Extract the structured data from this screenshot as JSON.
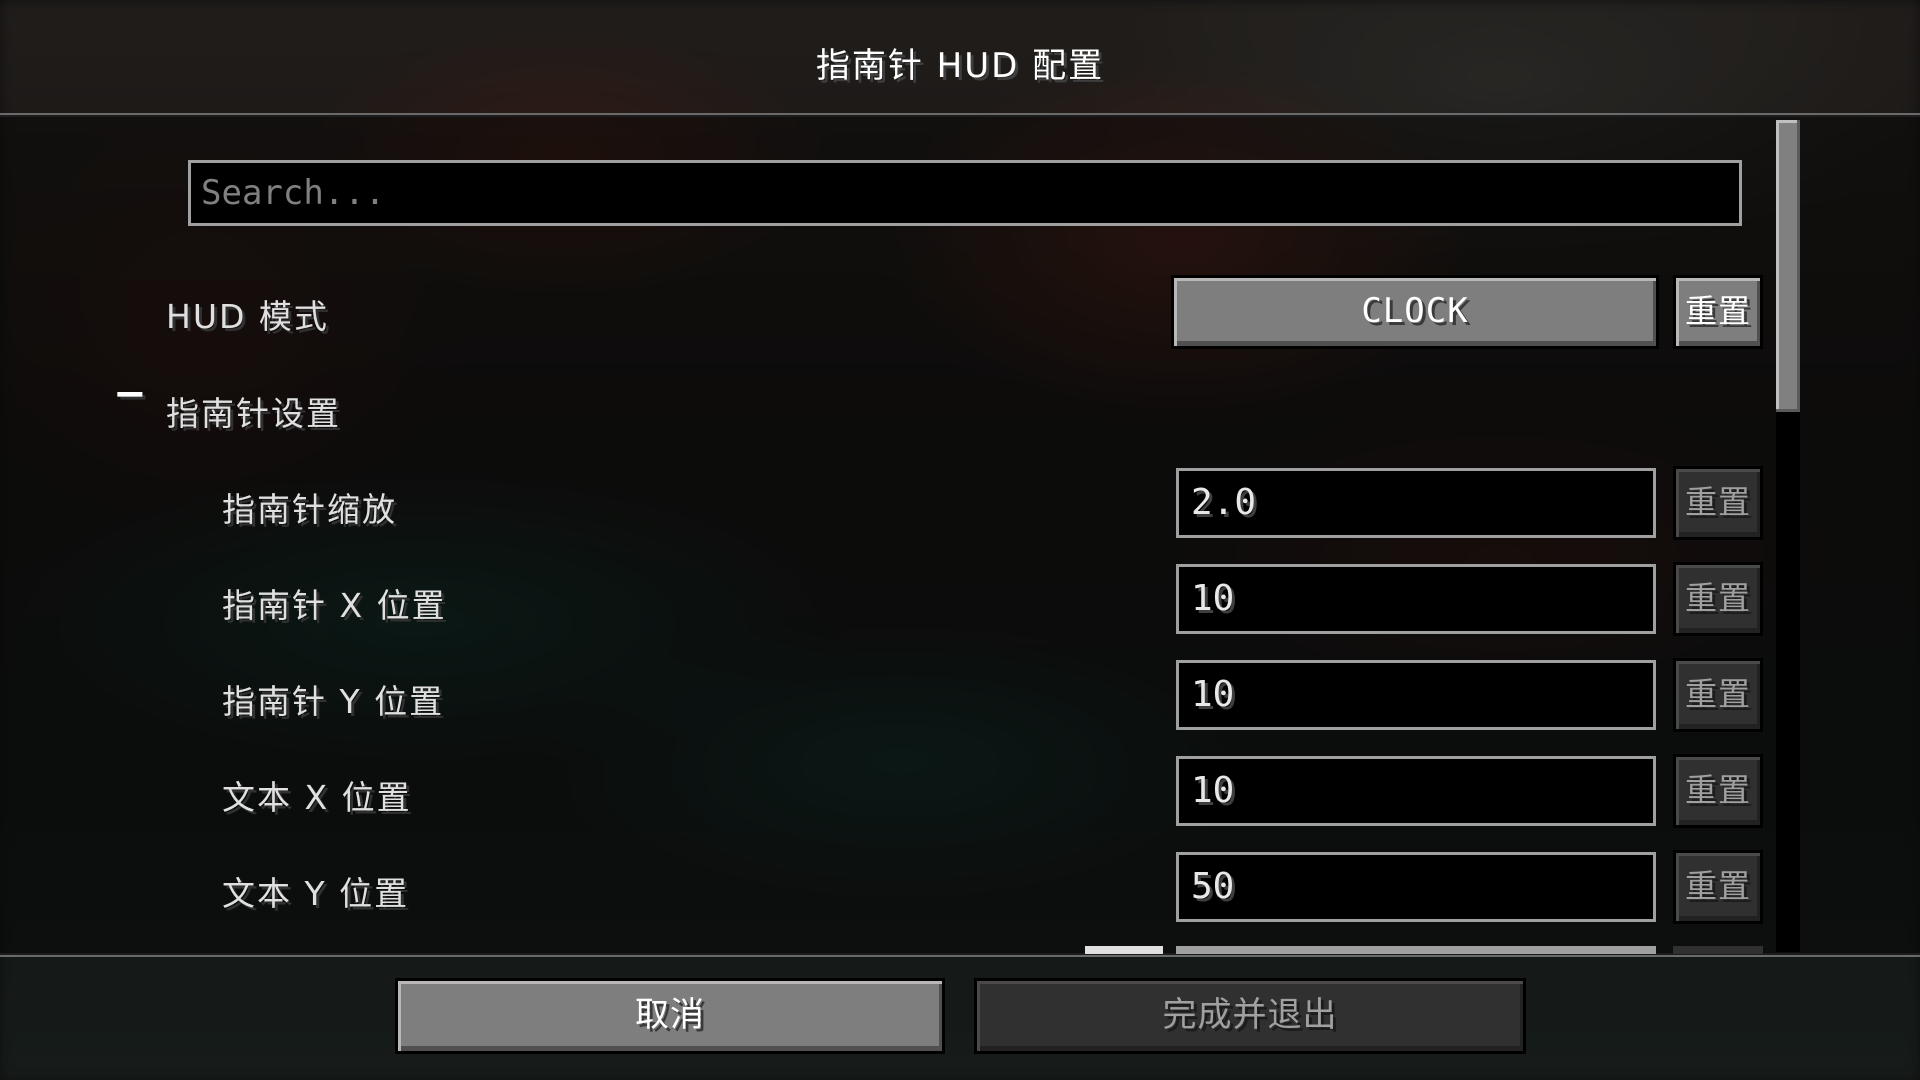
{
  "screen": {
    "title": "指南针 HUD 配置"
  },
  "search": {
    "placeholder": "Search..."
  },
  "settings": {
    "hud_mode": {
      "label": "HUD 模式",
      "value": "CLOCK",
      "reset_label": "重置"
    },
    "compass_section": {
      "toggle_symbol": "−",
      "label": "指南针设置",
      "expanded": true
    },
    "rows": [
      {
        "label": "指南针缩放",
        "value": "2.0",
        "reset_label": "重置"
      },
      {
        "label": "指南针 X 位置",
        "value": "10",
        "reset_label": "重置"
      },
      {
        "label": "指南针 Y 位置",
        "value": "10",
        "reset_label": "重置"
      },
      {
        "label": "文本 X 位置",
        "value": "10",
        "reset_label": "重置"
      },
      {
        "label": "文本 Y 位置",
        "value": "50",
        "reset_label": "重置"
      }
    ]
  },
  "footer": {
    "cancel_label": "取消",
    "done_label": "完成并退出"
  },
  "colors": {
    "button_gray": "#7e7e7e",
    "field_border": "#a0a0a0",
    "field_background": "#000000",
    "disabled_text": "#a0a0a0"
  },
  "scrollbar": {
    "position_fraction": 0.0,
    "visible_fraction": 0.35
  }
}
